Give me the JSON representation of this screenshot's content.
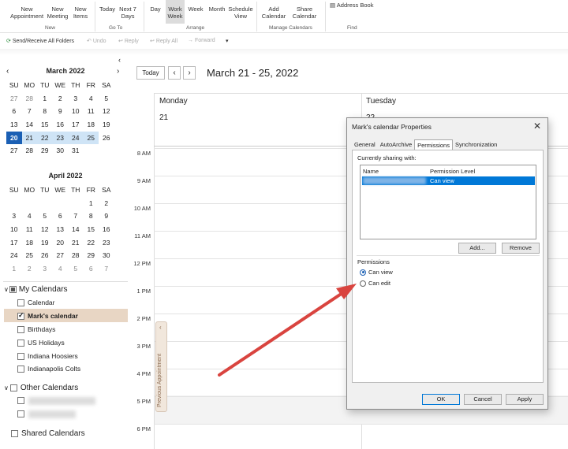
{
  "ribbon": {
    "new_appointment": "New Appointment",
    "new_meeting": "New Meeting",
    "new_items": "New Items",
    "today": "Today",
    "next7": "Next 7 Days",
    "day": "Day",
    "work_week": "Work Week",
    "week": "Week",
    "month": "Month",
    "schedule_view": "Schedule View",
    "add_calendar": "Add Calendar",
    "share_calendar": "Share Calendar",
    "address_book": "Address Book",
    "group_new": "New",
    "group_goto": "Go To",
    "group_arrange": "Arrange",
    "group_manage": "Manage Calendars",
    "group_find": "Find"
  },
  "quickbar": {
    "send_receive": "Send/Receive All Folders",
    "undo": "Undo",
    "reply": "Reply",
    "reply_all": "Reply All",
    "forward": "Forward"
  },
  "march": {
    "title": "March 2022",
    "headers": [
      "SU",
      "MO",
      "TU",
      "WE",
      "TH",
      "FR",
      "SA"
    ],
    "days": [
      "27",
      "28",
      "1",
      "2",
      "3",
      "4",
      "5",
      "6",
      "7",
      "8",
      "9",
      "10",
      "11",
      "12",
      "13",
      "14",
      "15",
      "16",
      "17",
      "18",
      "19",
      "20",
      "21",
      "22",
      "23",
      "24",
      "25",
      "26",
      "27",
      "28",
      "29",
      "30",
      "31"
    ]
  },
  "april": {
    "title": "April 2022",
    "headers": [
      "SU",
      "MO",
      "TU",
      "WE",
      "TH",
      "FR",
      "SA"
    ],
    "days": [
      "",
      "",
      "",
      "",
      "",
      "1",
      "2",
      "3",
      "4",
      "5",
      "6",
      "7",
      "8",
      "9",
      "10",
      "11",
      "12",
      "13",
      "14",
      "15",
      "16",
      "17",
      "18",
      "19",
      "20",
      "21",
      "22",
      "23",
      "24",
      "25",
      "26",
      "27",
      "28",
      "29",
      "30",
      "1",
      "2",
      "3",
      "4",
      "5",
      "6",
      "7"
    ]
  },
  "calendars": {
    "my_header": "My Calendars",
    "items": [
      "Calendar",
      "Mark's calendar",
      "Birthdays",
      "US Holidays",
      "Indiana Hoosiers",
      "Indianapolis Colts"
    ],
    "other_header": "Other Calendars",
    "shared_header": "Shared Calendars"
  },
  "main": {
    "today_btn": "Today",
    "date_range": "March 21 - 25, 2022",
    "col1_day": "Monday",
    "col1_date": "21",
    "col2_day": "Tuesday",
    "col2_date": "22",
    "times": [
      "8 AM",
      "9 AM",
      "10 AM",
      "11 AM",
      "12 PM",
      "1 PM",
      "2 PM",
      "3 PM",
      "4 PM",
      "5 PM",
      "6 PM"
    ],
    "prev_appointment": "Previous Appointment"
  },
  "dialog": {
    "title": "Mark's calendar Properties",
    "tabs": [
      "General",
      "AutoArchive",
      "Permissions",
      "Synchronization"
    ],
    "sharing_label": "Currently sharing with:",
    "col_name": "Name",
    "col_level": "Permission Level",
    "row_level": "Can view",
    "add": "Add...",
    "remove": "Remove",
    "permissions_label": "Permissions",
    "can_view": "Can view",
    "can_edit": "Can edit",
    "ok": "OK",
    "cancel": "Cancel",
    "apply": "Apply"
  },
  "colors": {
    "accent": "#1a5fb4",
    "arrow": "#d9443f"
  }
}
